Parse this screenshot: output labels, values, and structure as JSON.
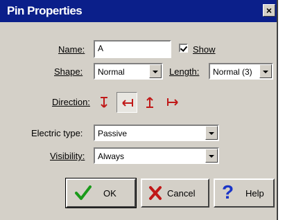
{
  "window": {
    "title": "Pin Properties",
    "close_glyph": "×"
  },
  "name_field": {
    "label": "Name:",
    "value": "A"
  },
  "show_checkbox": {
    "label": "Show",
    "checked": true
  },
  "shape": {
    "label": "Shape:",
    "value": "Normal"
  },
  "length": {
    "label": "Length:",
    "value": "Normal (3)"
  },
  "direction": {
    "label": "Direction:",
    "options": [
      "pin-down",
      "pin-left",
      "pin-up",
      "pin-right"
    ],
    "selected_index": 1,
    "color": "#c01818"
  },
  "electric_type": {
    "label": "Electric type:",
    "value": "Passive"
  },
  "visibility": {
    "label": "Visibility:",
    "value": "Always"
  },
  "buttons": {
    "ok": "OK",
    "cancel": "Cancel",
    "help": "Help"
  },
  "colors": {
    "titlebar": "#0b1f8a",
    "dialog_bg": "#d4d0c8",
    "ok_icon": "#1a9a1a",
    "cancel_icon": "#c01818",
    "help_icon": "#1a35c8"
  }
}
